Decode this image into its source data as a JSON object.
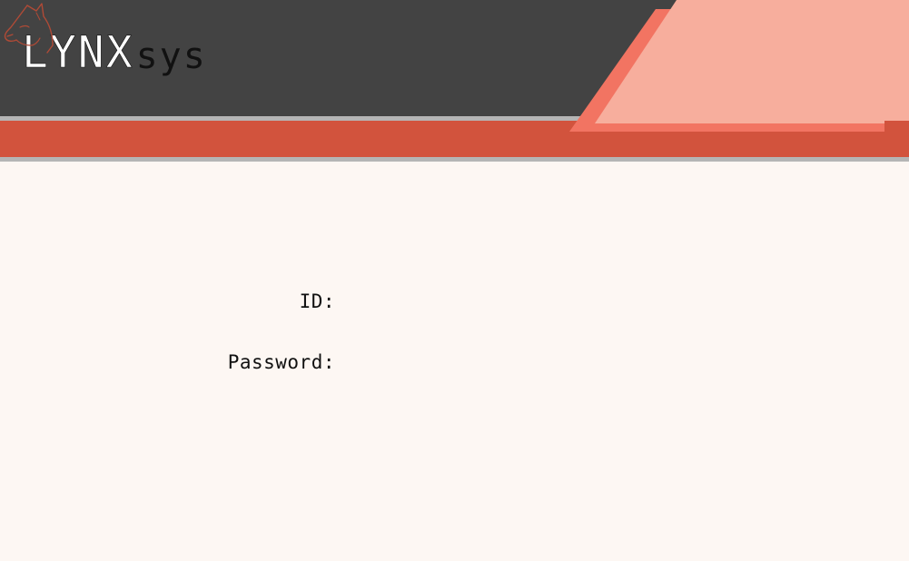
{
  "header": {
    "logo_main": "LYNX",
    "logo_sub": "sys",
    "logo_icon": "lynx-head-icon",
    "colors": {
      "dark_band": "#434343",
      "red_stripe": "#d2533d",
      "salmon_light": "#f7ae9d",
      "salmon_mid": "#f27462",
      "divider": "#b5b5b5",
      "background": "#fdf7f3"
    }
  },
  "login_form": {
    "id_label": "ID:",
    "id_value": "",
    "password_label": "Password:",
    "password_value": ""
  }
}
